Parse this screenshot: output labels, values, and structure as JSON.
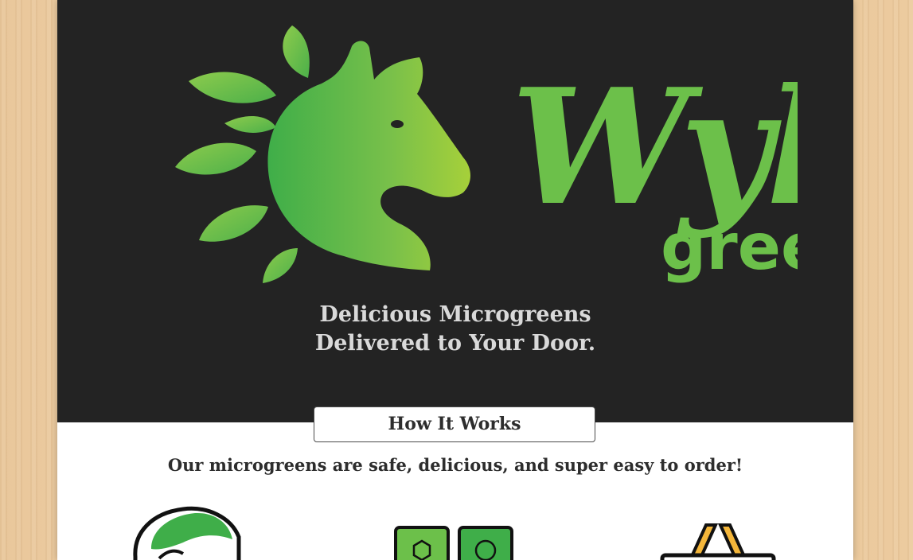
{
  "brand": {
    "wordmark": "Wyld",
    "sub_wordmark": "greens",
    "logo_icon": "horse-head-leaves-logo",
    "primary_green": "#6cc04a",
    "dark_bg": "#232323"
  },
  "hero": {
    "tagline_line1": "Delicious Microgreens",
    "tagline_line2": "Delivered to Your Door."
  },
  "how_it_works": {
    "button_label": "How It Works",
    "intro_text": "Our microgreens are safe, delicious, and super easy to order!",
    "steps": [
      {
        "icon": "microgreens-leaf-icon"
      },
      {
        "icon": "delivery-boxes-icon"
      },
      {
        "icon": "basket-icon"
      }
    ]
  }
}
